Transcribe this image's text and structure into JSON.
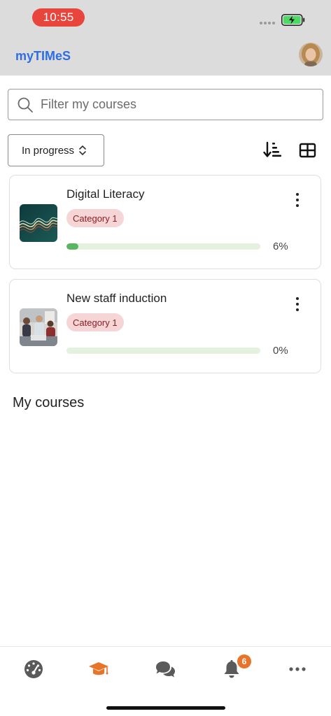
{
  "status_bar": {
    "time": "10:55",
    "battery_color": "#4cd964"
  },
  "header": {
    "app_title": "myTIMeS",
    "avatar_icon": "user-avatar"
  },
  "search": {
    "placeholder": "Filter my courses",
    "icon": "search-icon"
  },
  "filter": {
    "selected": "In progress",
    "icon": "chevron-updown-icon"
  },
  "toolbar": {
    "sort_icon": "sort-icon",
    "view_icon": "grid-view-icon"
  },
  "courses": [
    {
      "title": "Digital Literacy",
      "category": "Category 1",
      "progress_text": "6%",
      "progress": 0.06,
      "thumbnail": "wave-image"
    },
    {
      "title": "New staff induction",
      "category": "Category 1",
      "progress_text": "0%",
      "progress": 0.0,
      "thumbnail": "people-photo"
    }
  ],
  "section": {
    "title": "My courses"
  },
  "tab_bar": {
    "items": [
      {
        "icon": "dashboard-icon",
        "active": false
      },
      {
        "icon": "graduation-cap-icon",
        "active": true
      },
      {
        "icon": "chat-icon",
        "active": false
      },
      {
        "icon": "bell-icon",
        "active": false,
        "badge": "6"
      },
      {
        "icon": "more-icon",
        "active": false
      }
    ],
    "active_color": "#e8742a",
    "inactive_color": "#5a5a5a"
  },
  "colors": {
    "accent": "#2f6ee0",
    "time_pill": "#e8453c",
    "badge_bg": "#f6d5d6",
    "progress": "#5bb563"
  }
}
